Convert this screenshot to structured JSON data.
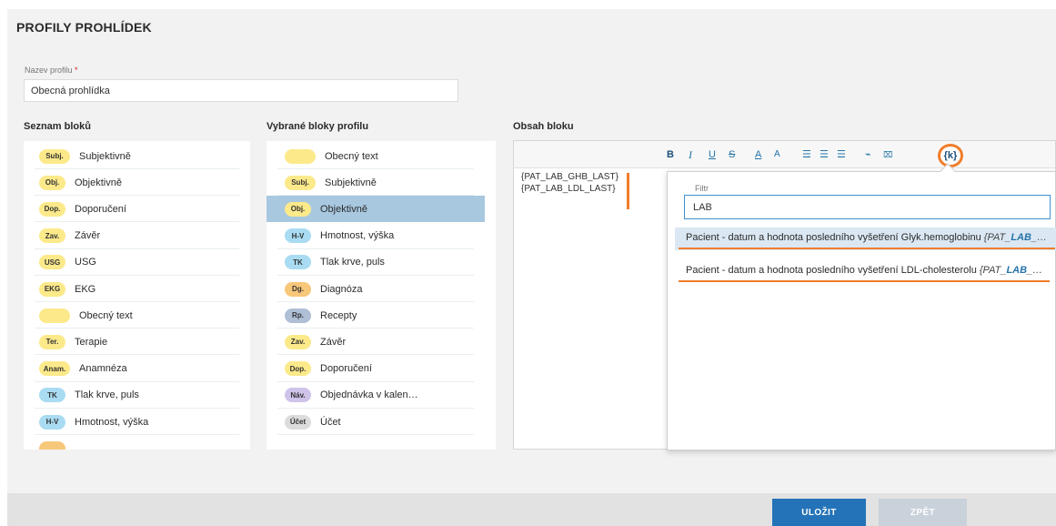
{
  "page": {
    "title": "PROFILY PROHLÍDEK"
  },
  "profile_name": {
    "label": "Nazev profilu",
    "required_mark": "*",
    "value": "Obecná prohlídka"
  },
  "columns": {
    "blocks_list": "Seznam bloků",
    "selected_blocks": "Vybrané bloky profilu",
    "block_content": "Obsah bloku"
  },
  "blocks_list": [
    {
      "badge": "Subj.",
      "label": "Subjektivně",
      "color": "#fce98a"
    },
    {
      "badge": "Obj.",
      "label": "Objektivně",
      "color": "#fce98a"
    },
    {
      "badge": "Dop.",
      "label": "Doporučení",
      "color": "#fce98a"
    },
    {
      "badge": "Zav.",
      "label": "Závěr",
      "color": "#fce98a"
    },
    {
      "badge": "USG",
      "label": "USG",
      "color": "#fce98a"
    },
    {
      "badge": "EKG",
      "label": "EKG",
      "color": "#fce98a"
    },
    {
      "badge": "",
      "label": "Obecný text",
      "color": "#fce98a"
    },
    {
      "badge": "Ter.",
      "label": "Terapie",
      "color": "#fce98a"
    },
    {
      "badge": "Anam.",
      "label": "Anamnéza",
      "color": "#fce98a"
    },
    {
      "badge": "TK",
      "label": "Tlak krve, puls",
      "color": "#a9dcf3"
    },
    {
      "badge": "H-V",
      "label": "Hmotnost, výška",
      "color": "#a9dcf3"
    }
  ],
  "selected_blocks": [
    {
      "badge": "",
      "label": "Obecný text",
      "color": "#fce98a",
      "selected": false
    },
    {
      "badge": "Subj.",
      "label": "Subjektivně",
      "color": "#fce98a",
      "selected": false
    },
    {
      "badge": "Obj.",
      "label": "Objektivně",
      "color": "#fce98a",
      "selected": true
    },
    {
      "badge": "H-V",
      "label": "Hmotnost, výška",
      "color": "#a9dcf3",
      "selected": false
    },
    {
      "badge": "TK",
      "label": "Tlak krve, puls",
      "color": "#a9dcf3",
      "selected": false
    },
    {
      "badge": "Dg.",
      "label": "Diagnóza",
      "color": "#f7c77a",
      "selected": false
    },
    {
      "badge": "Rp.",
      "label": "Recepty",
      "color": "#aebfd6",
      "selected": false
    },
    {
      "badge": "Zav.",
      "label": "Závěr",
      "color": "#fce98a",
      "selected": false
    },
    {
      "badge": "Dop.",
      "label": "Doporučení",
      "color": "#fce98a",
      "selected": false
    },
    {
      "badge": "Náv.",
      "label": "Objednávka v kalen…",
      "color": "#cfc3ea",
      "selected": false
    },
    {
      "badge": "Účet",
      "label": "Účet",
      "color": "#dcdcdc",
      "selected": false
    }
  ],
  "toolbar": {
    "bold": "B",
    "italic": "I",
    "underline": "U",
    "strike": "S",
    "font_color": "A",
    "bg_color": "A",
    "ordered_list": "☰",
    "bullet_list": "☰",
    "align": "☰",
    "link": "⌁",
    "unlink": "⌧",
    "insert_key": "{k}"
  },
  "editor": {
    "lines": [
      "{PAT_LAB_GHB_LAST}",
      "{PAT_LAB_LDL_LAST}"
    ]
  },
  "dropdown": {
    "filter_label": "Filtr",
    "filter_value": "LAB",
    "results": [
      {
        "text": "Pacient - datum a hodnota posledního vyšetření Glyk.hemoglobinu ",
        "tag_pre": "{PAT_",
        "tag_bold": "LAB",
        "tag_post": "_…",
        "highlighted": true
      },
      {
        "text": "Pacient - datum a hodnota posledního vyšetření LDL-cholesterolu ",
        "tag_pre": "{PAT_",
        "tag_bold": "LAB",
        "tag_post": "_…",
        "highlighted": false
      }
    ]
  },
  "buttons": {
    "save": "ULOŽIT",
    "back": "ZPĚT"
  },
  "colors": {
    "accent": "#2473b8",
    "highlight": "#f07d2a",
    "selected_row": "#a8c8e0"
  }
}
